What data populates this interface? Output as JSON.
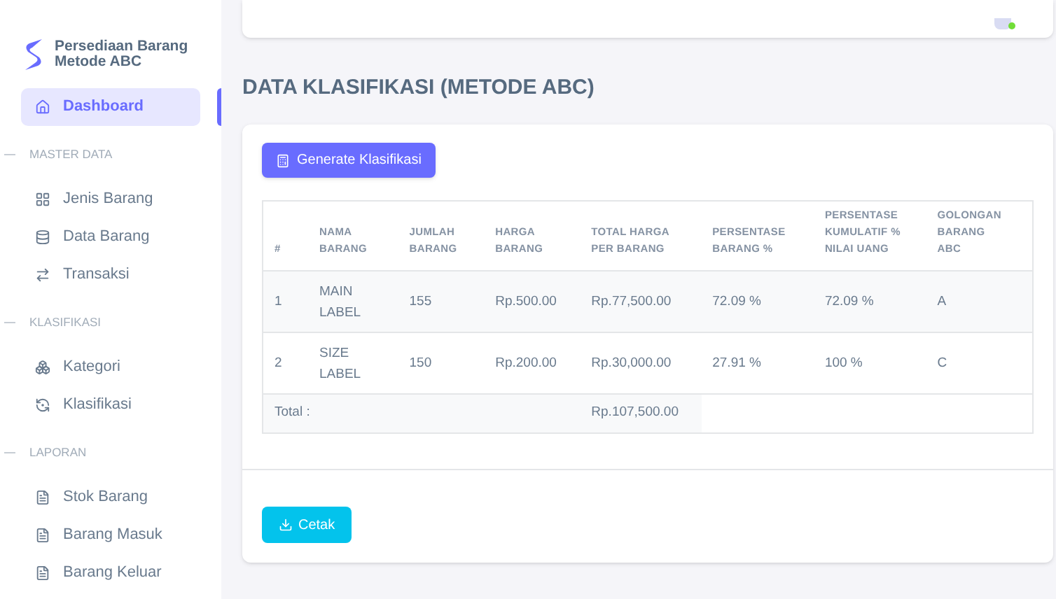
{
  "brand": {
    "name": "Persediaan Barang Metode ABC"
  },
  "sidebar": {
    "items": [
      {
        "kind": "link",
        "label": "Dashboard",
        "selected": true
      },
      {
        "kind": "header",
        "label": "MASTER DATA"
      },
      {
        "kind": "link",
        "label": "Jenis Barang",
        "selected": false
      },
      {
        "kind": "link",
        "label": "Data Barang",
        "selected": false
      },
      {
        "kind": "link",
        "label": "Transaksi",
        "selected": false
      },
      {
        "kind": "header",
        "label": "KLASIFIKASI"
      },
      {
        "kind": "link",
        "label": "Kategori",
        "selected": false
      },
      {
        "kind": "link",
        "label": "Klasifikasi",
        "selected": false
      },
      {
        "kind": "header",
        "label": "LAPORAN"
      },
      {
        "kind": "link",
        "label": "Stok Barang",
        "selected": false
      },
      {
        "kind": "link",
        "label": "Barang Masuk",
        "selected": false
      },
      {
        "kind": "link",
        "label": "Barang Keluar",
        "selected": false
      }
    ]
  },
  "page": {
    "title": "DATA KLASIFIKASI (METODE ABC)"
  },
  "generate_button": {
    "label": "Generate Klasifikasi"
  },
  "table": {
    "columns": [
      "#",
      "NAMA BARANG",
      "JUMLAH BARANG",
      "HARGA BARANG",
      "TOTAL HARGA PER BARANG",
      "PERSENTASE BARANG %",
      "PERSENTASE KUMULATIF % NILAI UANG",
      "GOLONGAN BARANG ABC"
    ],
    "rows": [
      [
        "1",
        "MAIN LABEL",
        "155",
        "Rp.500.00",
        "Rp.77,500.00",
        "72.09 %",
        "72.09 %",
        "A"
      ],
      [
        "2",
        "SIZE LABEL",
        "150",
        "Rp.200.00",
        "Rp.30,000.00",
        "27.91 %",
        "100 %",
        "C"
      ]
    ],
    "total": {
      "label": "Total :",
      "value": "Rp.107,500.00"
    }
  },
  "print_button": {
    "label": "Cetak"
  }
}
